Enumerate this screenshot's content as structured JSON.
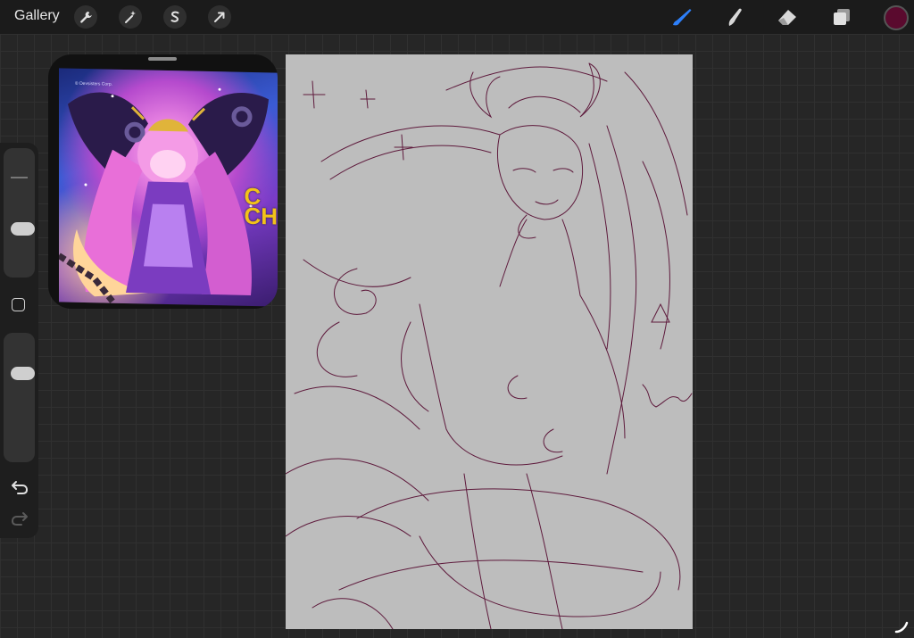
{
  "topbar": {
    "gallery_label": "Gallery",
    "left_tools": [
      {
        "name": "actions",
        "icon": "wrench-icon"
      },
      {
        "name": "adjustments",
        "icon": "magic-wand-icon"
      },
      {
        "name": "selection",
        "icon": "selection-s-icon"
      },
      {
        "name": "transform",
        "icon": "arrow-cursor-icon"
      }
    ],
    "right_tools": [
      {
        "name": "brush",
        "icon": "brush-icon",
        "active": true
      },
      {
        "name": "smudge",
        "icon": "smudge-icon"
      },
      {
        "name": "eraser",
        "icon": "eraser-icon"
      },
      {
        "name": "layers",
        "icon": "layers-icon"
      }
    ],
    "current_color": "#5a0a2e",
    "accent_color": "#2d7ff9"
  },
  "sidebar": {
    "brush_size_level": 0.2,
    "opacity_level": 0.7,
    "controls": [
      "brush-size-slider",
      "modify-button",
      "opacity-slider",
      "undo-icon",
      "redo-icon"
    ]
  },
  "reference": {
    "image_text": "C\nCH",
    "copyright": "© Devsisters Corp."
  },
  "canvas": {
    "background": "#bdbdbd",
    "sketch_color": "#5e1a3c"
  }
}
